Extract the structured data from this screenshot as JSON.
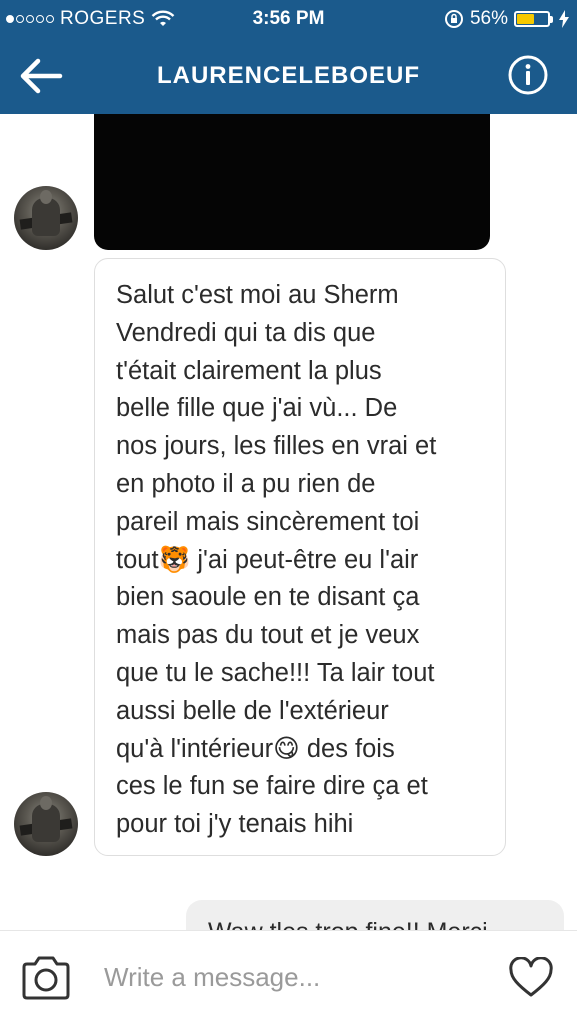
{
  "status_bar": {
    "carrier": "ROGERS",
    "signal_bars_filled": 1,
    "signal_bars_total": 5,
    "time": "3:56 PM",
    "battery_percent": "56%",
    "battery_level": 0.56,
    "battery_color": "#f6c900"
  },
  "header": {
    "title": "LAURENCELEBOEUF",
    "back_icon": "arrow-left-icon",
    "info_icon": "info-icon",
    "background_color": "#1b5a8c"
  },
  "messages": [
    {
      "type": "photo",
      "sender": "contact"
    },
    {
      "type": "text",
      "sender": "contact",
      "text": "Salut c'est moi au Sherm\nVendredi qui ta dis que\nt'était clairement la plus\nbelle fille que j'ai vù... De\nnos jours, les filles en vrai et\nen photo il a pu rien de\npareil mais sincèrement toi\ntout🐯 j'ai peut-être eu l'air\nbien saoule en te disant ça\nmais pas du tout et je veux\nque tu le sache!!! Ta lair tout\naussi belle de l'extérieur\nqu'à l'intérieur😋 des fois\nces le fun se faire dire ça et\npour toi j'y tenais hihi"
    },
    {
      "type": "text",
      "sender": "me",
      "text": "Waw tles trop fine!! Merci"
    }
  ],
  "composer": {
    "placeholder": "Write a message...",
    "camera_icon": "camera-icon",
    "heart_icon": "heart-icon"
  }
}
